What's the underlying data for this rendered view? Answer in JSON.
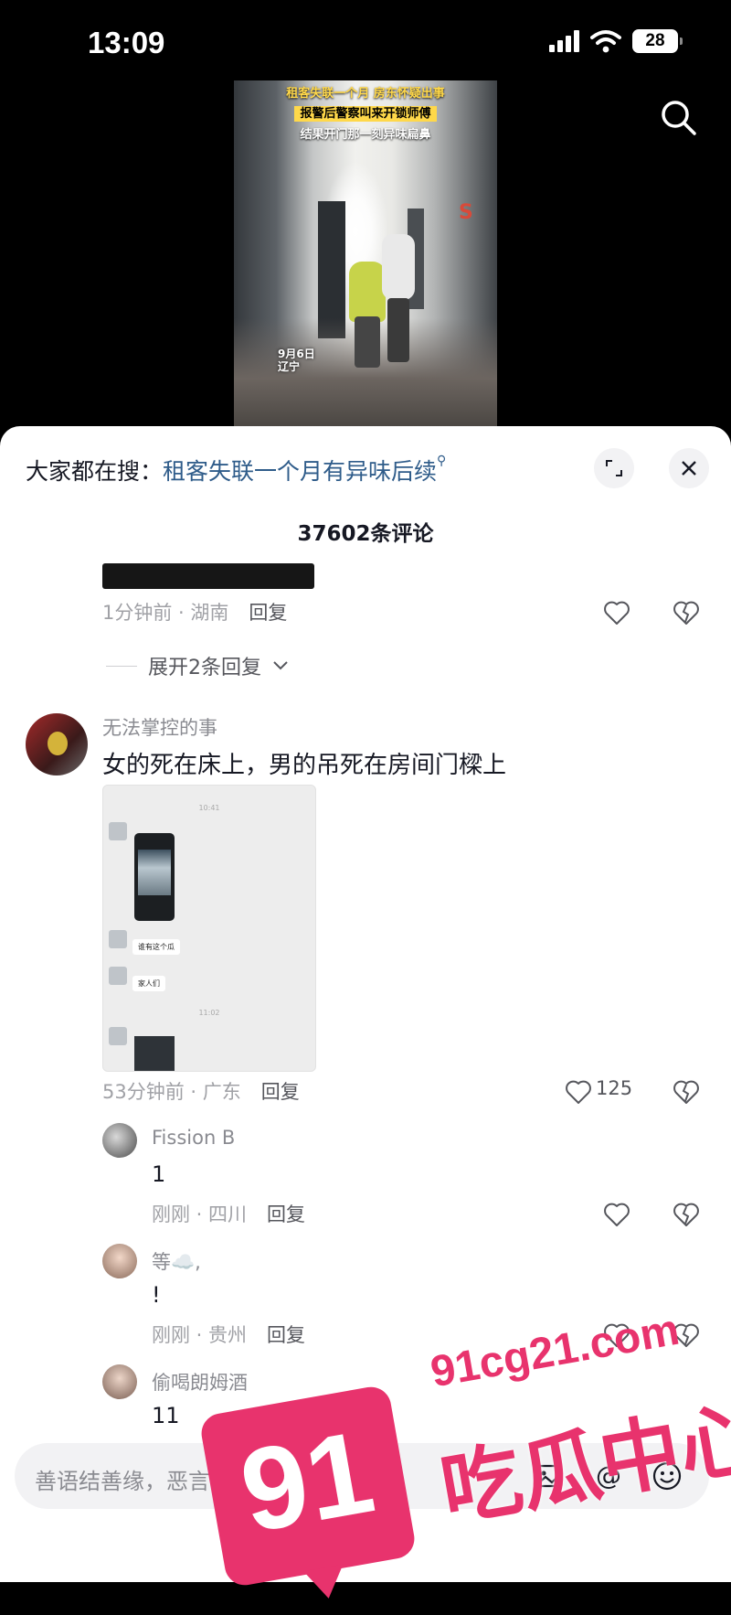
{
  "status_bar": {
    "time": "13:09",
    "battery": "28"
  },
  "video": {
    "caption_line1": "租客失联一个月 房东怀疑出事",
    "caption_line2": "报警后警察叫来开锁师傅",
    "caption_line3": "结果开门那一刻异味扁鼻",
    "date_line1": "9月6日",
    "date_line2": "辽宁"
  },
  "search_suggest": {
    "label": "大家都在搜：",
    "query": "租客失联一个月有异味后续"
  },
  "comment_count": "37602条评论",
  "comments": [
    {
      "time": "1分钟前",
      "location": "湖南",
      "reply": "回复",
      "likes": ""
    },
    {
      "expand": "展开2条回复"
    },
    {
      "author": "无法掌控的事",
      "text": "女的死在床上，男的吊死在房间门樑上",
      "time": "53分钟前",
      "location": "广东",
      "reply": "回复",
      "likes": "125",
      "image": {
        "time1": "10:41",
        "bubble1": "谁有这个瓜",
        "bubble2": "家人们",
        "time2": "11:02"
      }
    }
  ],
  "replies": [
    {
      "author": "Fission B",
      "text": "1",
      "time": "刚刚",
      "location": "四川",
      "reply": "回复"
    },
    {
      "author": "等☁️,",
      "text": "!",
      "time": "刚刚",
      "location": "贵州",
      "reply": "回复"
    },
    {
      "author": "偷喝朗姆酒",
      "text": "11"
    }
  ],
  "input": {
    "placeholder": "善语结善缘，恶言伤人心"
  },
  "watermark": {
    "number": "91",
    "site": "91cg21.com",
    "name": "吃瓜中心"
  },
  "colors": {
    "accent_link": "#2f5c8a",
    "watermark_pink": "#e8336d",
    "text_primary": "#161823",
    "text_secondary": "#a0a1a6"
  }
}
